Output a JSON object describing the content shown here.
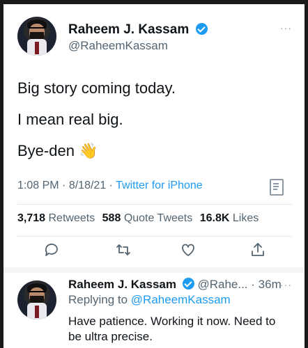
{
  "main_tweet": {
    "author_name": "Raheem J. Kassam",
    "author_handle": "@RaheemKassam",
    "text_lines": [
      "Big story coming today.",
      "I mean real big.",
      "Bye-den"
    ],
    "emoji": "👋",
    "time": "1:08 PM",
    "date": "8/18/21",
    "dot": "·",
    "source": "Twitter for iPhone",
    "more": "···",
    "stats": {
      "retweets_count": "3,718",
      "retweets_label": "Retweets",
      "quote_count": "588",
      "quote_label": "Quote Tweets",
      "likes_count": "16.8K",
      "likes_label": "Likes"
    }
  },
  "reply_tweet": {
    "author_name": "Raheem J. Kassam",
    "author_handle_truncated": "@Rahe...",
    "dot": "·",
    "time_ago": "36m",
    "more": "···",
    "replying_prefix": "Replying to",
    "replying_handle": "@RaheemKassam",
    "text": "Have patience. Working it now. Need to be ultra precise."
  },
  "icons": {
    "reply": "reply-icon",
    "retweet": "retweet-icon",
    "like": "heart-icon",
    "share": "share-icon",
    "verified": "verified-badge-icon",
    "analytics": "analytics-icon"
  },
  "colors": {
    "accent": "#1d9bf0",
    "text": "#0f1419",
    "secondary": "#536471"
  }
}
